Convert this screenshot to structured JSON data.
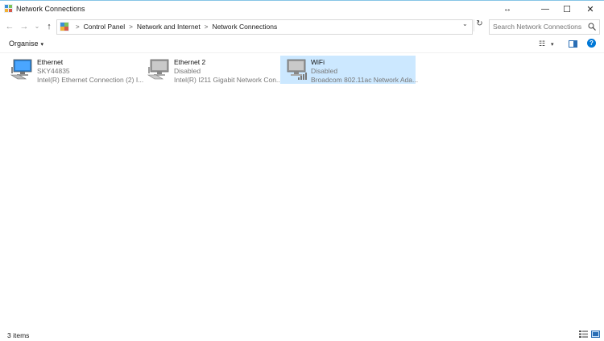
{
  "window": {
    "title": "Network Connections",
    "restore_glyph": "↔",
    "minimize_glyph": "—",
    "maximize_glyph": "☐",
    "close_glyph": "✕"
  },
  "nav": {
    "back_glyph": "←",
    "forward_glyph": "→",
    "history_glyph": "⌄",
    "up_glyph": "↑"
  },
  "address": {
    "breadcrumbs": [
      "Control Panel",
      "Network and Internet",
      "Network Connections"
    ],
    "separator": ">",
    "dropdown_glyph": "⌄",
    "refresh_glyph": "↻"
  },
  "search": {
    "placeholder": "Search Network Connections"
  },
  "toolbar": {
    "organise_label": "Organise",
    "caret_glyph": "▾",
    "view_glyph": "☷",
    "help_glyph": "?"
  },
  "connections": [
    {
      "name": "Ethernet",
      "status": "SKY44835",
      "adapter": "Intel(R) Ethernet Connection (2) I...",
      "icon": "network-cable-icon",
      "selected": false
    },
    {
      "name": "Ethernet 2",
      "status": "Disabled",
      "adapter": "Intel(R) I211 Gigabit Network Con...",
      "icon": "network-cable-icon",
      "selected": false
    },
    {
      "name": "WiFi",
      "status": "Disabled",
      "adapter": "Broadcom 802.11ac Network Ada...",
      "icon": "wifi-signal-icon",
      "selected": true
    }
  ],
  "statusbar": {
    "item_count": "3 items"
  },
  "colors": {
    "selection": "#cce8ff",
    "accent_blue": "#0078d7"
  }
}
